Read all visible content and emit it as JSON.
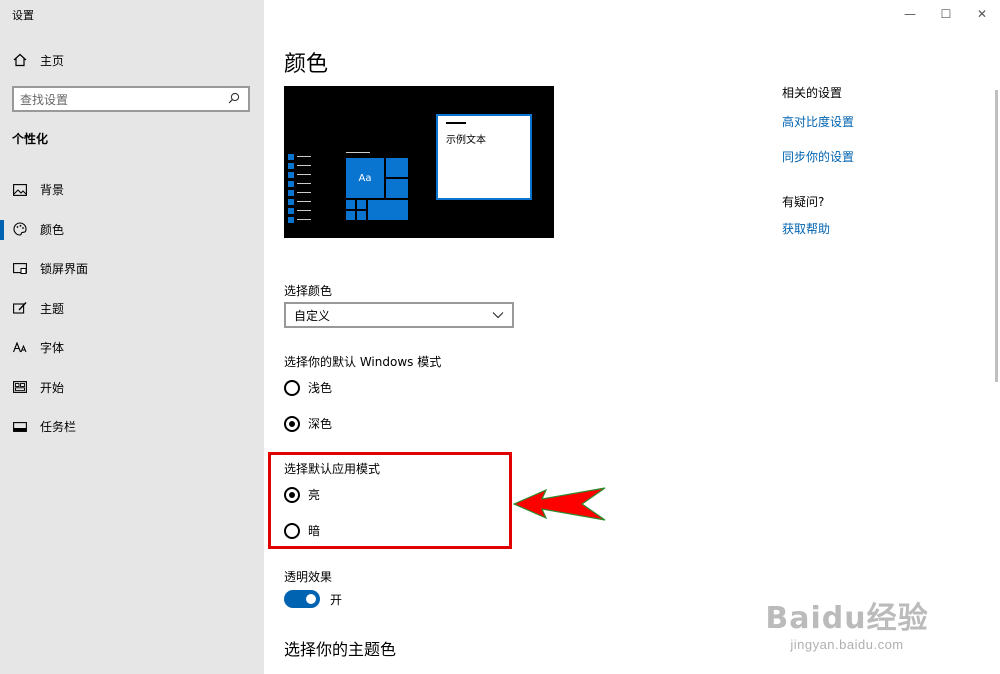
{
  "window": {
    "title": "设置",
    "controls": {
      "minimize": "—",
      "maximize": "☐",
      "close": "✕"
    }
  },
  "sidebar": {
    "home_label": "主页",
    "search_placeholder": "查找设置",
    "section_title": "个性化",
    "items": [
      {
        "label": "背景",
        "icon": "picture-icon"
      },
      {
        "label": "颜色",
        "icon": "palette-icon",
        "active": true
      },
      {
        "label": "锁屏界面",
        "icon": "lock-screen-icon"
      },
      {
        "label": "主题",
        "icon": "theme-brush-icon"
      },
      {
        "label": "字体",
        "icon": "font-icon"
      },
      {
        "label": "开始",
        "icon": "start-tiles-icon"
      },
      {
        "label": "任务栏",
        "icon": "taskbar-icon"
      }
    ]
  },
  "main": {
    "page_title": "颜色",
    "preview": {
      "sample_text": "示例文本",
      "tile_text": "Aa"
    },
    "choose_color": {
      "label": "选择颜色",
      "value": "自定义"
    },
    "windows_mode": {
      "label": "选择你的默认 Windows 模式",
      "options": [
        {
          "label": "浅色",
          "selected": false
        },
        {
          "label": "深色",
          "selected": true
        }
      ]
    },
    "app_mode": {
      "label": "选择默认应用模式",
      "options": [
        {
          "label": "亮",
          "selected": true
        },
        {
          "label": "暗",
          "selected": false
        }
      ]
    },
    "transparency": {
      "label": "透明效果",
      "state": "开",
      "on": true
    },
    "accent_title": "选择你的主题色"
  },
  "related": {
    "heading": "相关的设置",
    "links": [
      "高对比度设置",
      "同步你的设置"
    ]
  },
  "help": {
    "heading": "有疑问?",
    "link": "获取帮助"
  },
  "colors": {
    "accent": "#0063b1",
    "tile_blue": "#0a74d1",
    "sidebar_bg": "#e6e6e6",
    "highlight_red": "#e10000",
    "arrow_red": "#ff0000",
    "arrow_outline": "#2e8b2e"
  },
  "watermark": {
    "logo": "Baidu经验",
    "url": "jingyan.baidu.com"
  }
}
